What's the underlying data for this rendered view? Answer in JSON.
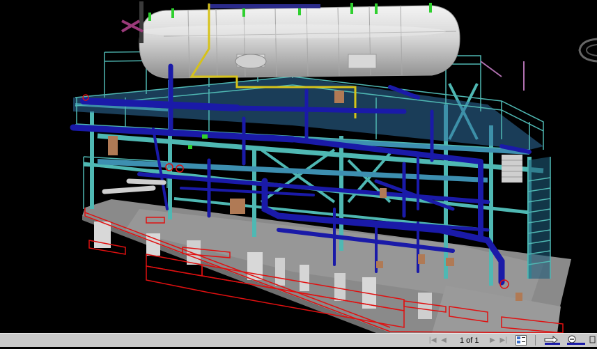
{
  "statusbar": {
    "page_indicator": "1 of 1",
    "icons": [
      "first-page-icon",
      "previous-page-icon",
      "next-page-icon",
      "last-page-icon",
      "page-thumbnails-icon",
      "forward-arrow-icon",
      "zoom-out-icon",
      "fit-window-icon"
    ]
  },
  "scene": {
    "subject": "3D process module model",
    "colors": {
      "background": "#000000",
      "structural_steel": "#4fb8b3",
      "piping": "#1a1aa8",
      "vessel": "#d8d8d8",
      "deck": "#8a8a8a",
      "outline": "#e01010",
      "valves": "#2fd02f",
      "yellow_pipe": "#d6c21a",
      "copper": "#b07a55"
    }
  }
}
